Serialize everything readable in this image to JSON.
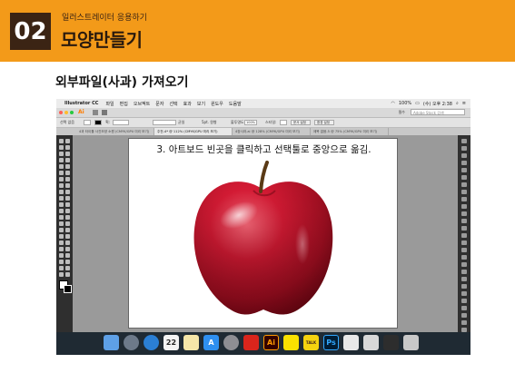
{
  "slide": {
    "badge": "02",
    "subtitle": "일러스트레이터 응용하기",
    "title": "모양만들기",
    "section_title": "외부파일(사과) 가져오기"
  },
  "colors": {
    "header_bg": "#f39a19",
    "badge_bg": "#3b2414",
    "illustrator_accent": "#ff7c00"
  },
  "mac_menu": {
    "app_name": "Illustrator CC",
    "items": [
      "파일",
      "편집",
      "오브젝트",
      "문자",
      "선택",
      "효과",
      "보기",
      "윈도우",
      "도움말"
    ],
    "battery": "100%",
    "clock": "(수) 오후 2:38"
  },
  "ai_toolbar": {
    "logo": "Ai",
    "workspace": "필수",
    "search_placeholder": "Adobe Stock 검색"
  },
  "control_bar": {
    "label_none": "선택 없음",
    "stroke_label": "획:",
    "brush_label": "균일",
    "points_label": "5pt. 원형",
    "opacity_label": "불투명도:",
    "opacity_value": "100%",
    "style_label": "스타일:",
    "doc_setup": "문서 설정",
    "prefs": "환경 설정"
  },
  "tabs": [
    {
      "label": "4과 타이틀 사진모양 소원 (CMYK/GPU 미리 보기)"
    },
    {
      "label": "주전-4* @ 112% (CMYK/GPU 미리 보기)"
    },
    {
      "label": "4장사과.ai @ 128% (CMYK/GPU 미리 보기)"
    },
    {
      "label": "제목 없음-5 @ 75% (CMYK/GPU 미리 보기)"
    }
  ],
  "artboard": {
    "instruction": "3. 아트보드 빈곳을 클릭하고 선택툴로 중앙으로 옮김."
  },
  "dock": {
    "items": [
      {
        "name": "finder-icon",
        "label": "",
        "bg": "#5ea0e6"
      },
      {
        "name": "launchpad-icon",
        "label": "",
        "bg": "#6d7a8a"
      },
      {
        "name": "safari-icon",
        "label": "",
        "bg": "#2b7fd4"
      },
      {
        "name": "calendar-icon",
        "label": "22",
        "bg": "#f4f4f4"
      },
      {
        "name": "notes-icon",
        "label": "",
        "bg": "#f5e6a8"
      },
      {
        "name": "app-store-icon",
        "label": "A",
        "bg": "#2e8ff0"
      },
      {
        "name": "system-prefs-icon",
        "label": "",
        "bg": "#8e8e93"
      },
      {
        "name": "acrobat-icon",
        "label": "",
        "bg": "#d9251c"
      },
      {
        "name": "illustrator-icon",
        "label": "Ai",
        "bg": "#330000"
      },
      {
        "name": "kakaotalk-icon",
        "label": "",
        "bg": "#fae100"
      },
      {
        "name": "talk-icon",
        "label": "TALK",
        "bg": "#f5d20f"
      },
      {
        "name": "photoshop-icon",
        "label": "Ps",
        "bg": "#001d34"
      },
      {
        "name": "preview-icon",
        "label": "",
        "bg": "#e8e8e8"
      },
      {
        "name": "keynote-icon",
        "label": "",
        "bg": "#d8d8d8"
      },
      {
        "name": "terminal-icon",
        "label": "",
        "bg": "#2d2d2d"
      },
      {
        "name": "trash-icon",
        "label": "",
        "bg": "#c8c8c8"
      }
    ]
  }
}
